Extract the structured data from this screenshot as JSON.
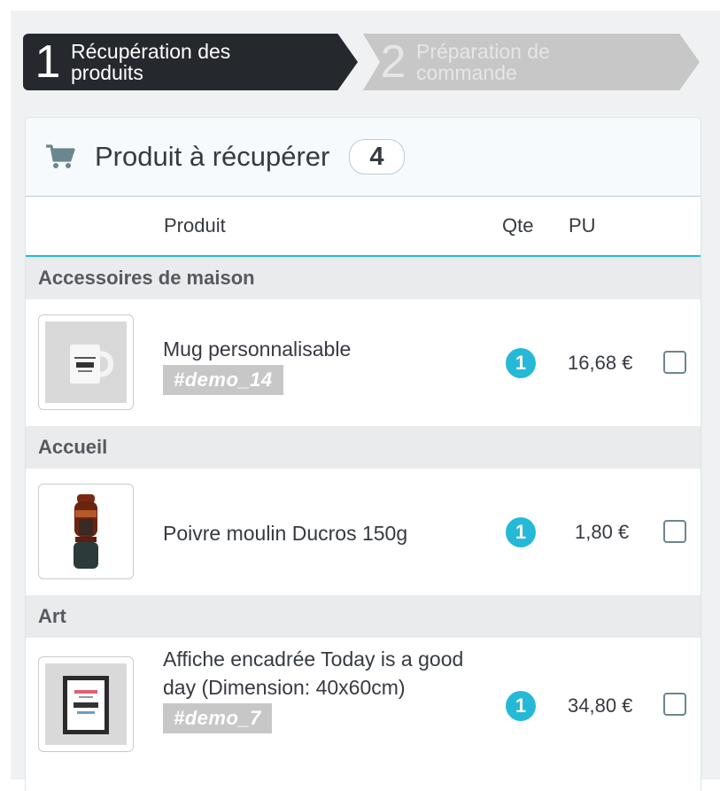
{
  "steps": [
    {
      "number": "1",
      "label": "Récupération des\nproduits",
      "active": true
    },
    {
      "number": "2",
      "label": "Préparation de\ncommande",
      "active": false
    }
  ],
  "panel": {
    "icon": "cart-icon",
    "title": "Produit à récupérer",
    "count": "4"
  },
  "table": {
    "headers": {
      "product": "Produit",
      "qty": "Qte",
      "price": "PU"
    }
  },
  "categories": [
    {
      "name": "Accessoires de maison",
      "item": {
        "name": "Mug personnalisable",
        "ref": "#demo_14",
        "qty": "1",
        "price": "16,68 €",
        "thumb": "mug-image"
      }
    },
    {
      "name": "Accueil",
      "item": {
        "name": "Poivre moulin Ducros 150g",
        "ref": "",
        "qty": "1",
        "price": "1,80 €",
        "thumb": "pepper-mill-image"
      }
    },
    {
      "name": "Art",
      "item": {
        "name": "Affiche encadrée Today is a good day (Dimension: 40x60cm)",
        "ref": "#demo_7",
        "qty": "1",
        "price": "34,80 €",
        "thumb": "framed-poster-image"
      }
    }
  ],
  "colors": {
    "accent": "#25b9d7",
    "dark": "#25282d",
    "muted": "#c7c7c7"
  }
}
